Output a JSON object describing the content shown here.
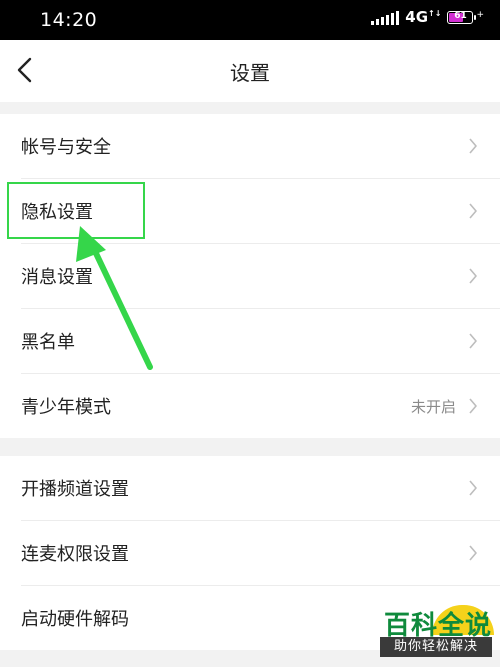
{
  "status_bar": {
    "time": "14:20",
    "network": "4G",
    "battery": "61"
  },
  "nav": {
    "title": "设置"
  },
  "settings": {
    "group1": [
      {
        "label": "帐号与安全"
      },
      {
        "label": "隐私设置"
      },
      {
        "label": "消息设置"
      },
      {
        "label": "黑名单"
      },
      {
        "label": "青少年模式",
        "value": "未开启"
      }
    ],
    "group2": [
      {
        "label": "开播频道设置"
      },
      {
        "label": "连麦权限设置"
      },
      {
        "label": "启动硬件解码"
      }
    ]
  },
  "watermark": {
    "title": "百科全说",
    "subtitle": "助你轻松解决"
  },
  "colors": {
    "highlight": "#35d64a",
    "battery": "#d22fd2"
  }
}
